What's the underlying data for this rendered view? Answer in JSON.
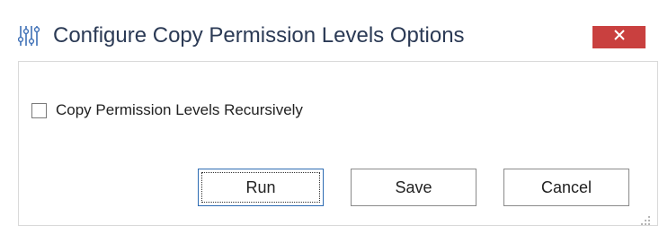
{
  "window": {
    "title": "Configure Copy Permission Levels Options",
    "app_icon": "sliders-icon",
    "close_icon": "close-icon",
    "accent_color": "#c9403f",
    "title_color": "#2b3a55"
  },
  "options": {
    "recursive_checkbox": {
      "label": "Copy Permission Levels Recursively",
      "checked": false
    }
  },
  "buttons": {
    "run_label": "Run",
    "save_label": "Save",
    "cancel_label": "Cancel",
    "default_button": "Run"
  }
}
